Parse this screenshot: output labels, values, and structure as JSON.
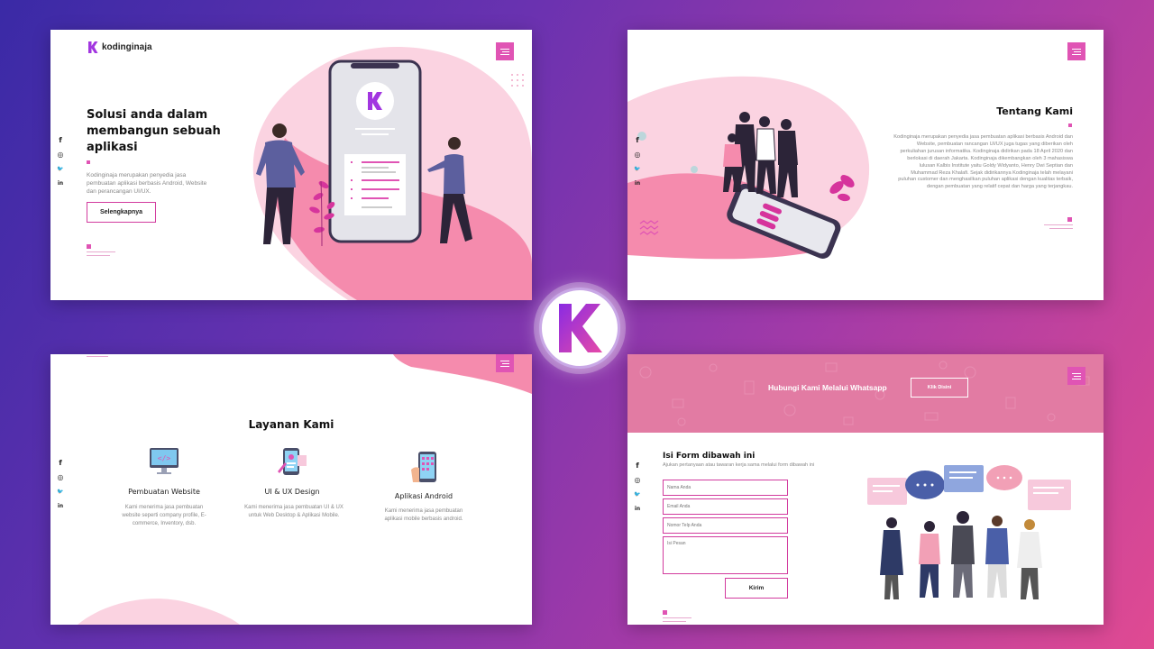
{
  "brand": {
    "name": "kodinginaja",
    "logo_letter": "K"
  },
  "colors": {
    "accent": "#e054b4",
    "pink_light": "#f7c9dc",
    "pink": "#f17aa5",
    "purple_bg": "#6a32b0"
  },
  "hero": {
    "title_lines": [
      "Solusi anda dalam",
      "membangun sebuah",
      "aplikasi"
    ],
    "description": "Kodinginaja merupakan penyedia jasa pembuatan aplikasi berbasis Android, Website dan perancangan UI/UX.",
    "cta_label": "Selengkapnya"
  },
  "about": {
    "title": "Tentang Kami",
    "body": "Kodinginaja merupakan penyedia jasa pembuatan aplikasi berbasis Android dan Website, pembuatan rancangan UI/UX juga tugas yang diberikan oleh perkuliahan jurusan informatika. Kodinginaja didirikan pada 18 April 2020 dan berlokasi di daerah Jakarta. Kodinginaja dikembangkan oleh 3 mahasiswa lulusan Kalbis Institute yaitu Goldy Widyanto, Henry Dwi Septian dan Muhammad Reza Khalafi. Sejak didirikannya Kodinginaja telah melayani puluhan customer dan menghasilkan puluhan aplikasi dengan kualitas terbaik, dengan pembuatan yang relatif cepat dan harga yang terjangkau."
  },
  "services": {
    "title": "Layanan Kami",
    "items": [
      {
        "title": "Pembuatan Website",
        "desc": "Kami menerima jasa pembuatan website seperti company profile, E-commerce, Inventory, dsb.",
        "icon": "monitor-code-icon"
      },
      {
        "title": "UI & UX Design",
        "desc": "Kami menerima jasa pembuatan UI & UX untuk Web Desktop & Aplikasi Mobile.",
        "icon": "ux-design-icon"
      },
      {
        "title": "Aplikasi Android",
        "desc": "Kami menerima jasa pembuatan aplikasi mobile berbasis android.",
        "icon": "android-phone-icon"
      }
    ]
  },
  "contact": {
    "banner_text": "Hubungi Kami Melalui Whatsapp",
    "banner_button": "Klik Disini",
    "form_title": "Isi Form dibawah ini",
    "form_subtitle": "Ajukan pertanyaan atau tawaran kerja sama melalui form dibawah ini",
    "fields": {
      "name_placeholder": "Nama Anda",
      "email_placeholder": "Email Anda",
      "phone_placeholder": "Nomor Telp Anda",
      "message_placeholder": "Isi Pesan"
    },
    "submit_label": "Kirim"
  },
  "social_icons": [
    "facebook-icon",
    "instagram-icon",
    "twitter-icon",
    "linkedin-icon"
  ],
  "social_glyphs": {
    "facebook": "f",
    "instagram": "◎",
    "twitter": "🐦",
    "linkedin": "in"
  }
}
